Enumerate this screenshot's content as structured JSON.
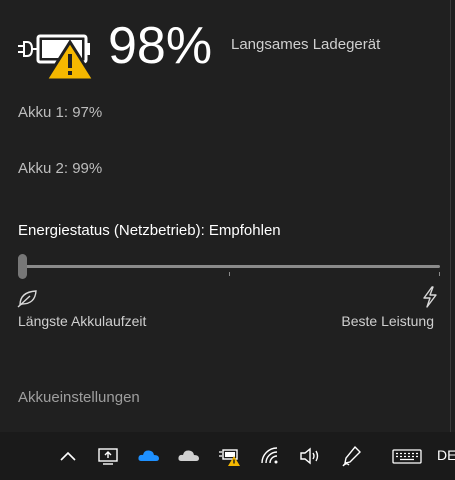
{
  "battery": {
    "percent": "98%",
    "charger_status": "Langsames Ladegerät",
    "warning_color": "#f5b800"
  },
  "akku": [
    {
      "label": "Akku 1: 97%"
    },
    {
      "label": "Akku 2: 99%"
    }
  ],
  "power_mode": {
    "title": "Energiestatus (Netzbetrieb): Empfohlen",
    "left_label": "Längste Akkulaufzeit",
    "right_label": "Beste Leistung",
    "slider_level": 0,
    "left_icon": "leaf-icon",
    "right_icon": "lightning-bolt-icon"
  },
  "settings_link": "Akkueinstellungen",
  "taskbar": {
    "icons": [
      "chevron-up-icon",
      "display-projection-icon",
      "onedrive-blue-cloud-icon",
      "onedrive-grey-cloud-icon",
      "battery-warning-icon",
      "wifi-icon",
      "volume-icon",
      "pen-icon",
      "keyboard-icon"
    ],
    "language": "DE"
  }
}
